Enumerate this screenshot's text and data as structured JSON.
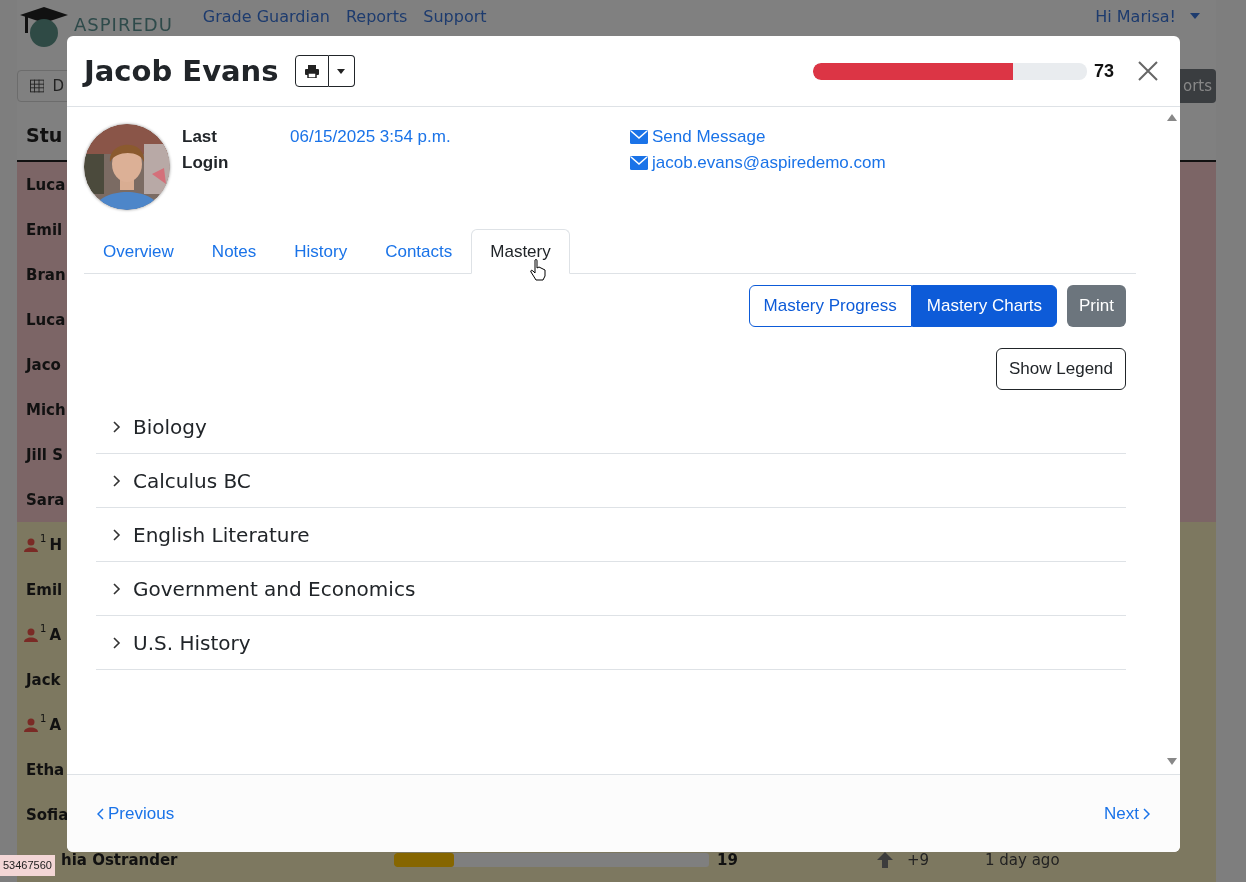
{
  "background": {
    "brand": "ASPIREDU",
    "nav": [
      "Grade Guardian",
      "Reports",
      "Support"
    ],
    "user_menu": "Hi Marisa!",
    "toolbar_button": "D",
    "right_button": "orts",
    "heading": "Stu",
    "rows": [
      {
        "name": "Luca",
        "color": "#7c6566"
      },
      {
        "name": "Emil",
        "color": "#7c6566"
      },
      {
        "name": "Bran",
        "color": "#7c6566"
      },
      {
        "name": "Luca",
        "color": "#7c6566"
      },
      {
        "name": "Jaco",
        "color": "#7c6566"
      },
      {
        "name": "Mich",
        "color": "#7c6566"
      },
      {
        "name": "Jill S",
        "color": "#7c6566"
      },
      {
        "name": "Sara",
        "color": "#7c6566"
      },
      {
        "name": "H",
        "badge": "1",
        "color": "#7d7860"
      },
      {
        "name": "Emil",
        "color": "#7d7860"
      },
      {
        "name": "A",
        "badge": "1",
        "color": "#7d7860"
      },
      {
        "name": "Jack",
        "color": "#7d7860"
      },
      {
        "name": "A",
        "badge": "1",
        "color": "#7d7860"
      },
      {
        "name": "Etha",
        "color": "#7d7860"
      },
      {
        "name": "Sofia",
        "color": "#7d7860"
      }
    ],
    "last_row": {
      "name": "hia Ostrander",
      "level": 0.19,
      "score": "19",
      "change": "+9",
      "when": "1 day ago",
      "color": "#7d7860"
    },
    "tooltip": "53467560"
  },
  "modal": {
    "title": "Jacob Evans",
    "score": {
      "level": 0.73,
      "value": "73"
    },
    "profile": {
      "label": "Last Login",
      "last_login": "06/15/2025 3:54 p.m.",
      "links": [
        "Send Message",
        "jacob.evans@aspiredemo.com"
      ]
    },
    "tabs": [
      {
        "label": "Overview",
        "selected": false
      },
      {
        "label": "Notes",
        "selected": false
      },
      {
        "label": "History",
        "selected": false
      },
      {
        "label": "Contacts",
        "selected": false
      },
      {
        "label": "Mastery",
        "selected": true
      }
    ],
    "view_buttons": [
      {
        "label": "Mastery Progress",
        "selected": false
      },
      {
        "label": "Mastery Charts",
        "selected": true
      }
    ],
    "print_button": "Print",
    "legend_button": "Show Legend",
    "subjects": [
      {
        "label": "Biology",
        "expanded": false
      },
      {
        "label": "Calculus BC",
        "expanded": false
      },
      {
        "label": "English Literature",
        "expanded": false
      },
      {
        "label": "Government and Economics",
        "expanded": false
      },
      {
        "label": "U.S. History",
        "expanded": false
      }
    ],
    "footer": {
      "previous": "Previous",
      "next": "Next"
    }
  }
}
